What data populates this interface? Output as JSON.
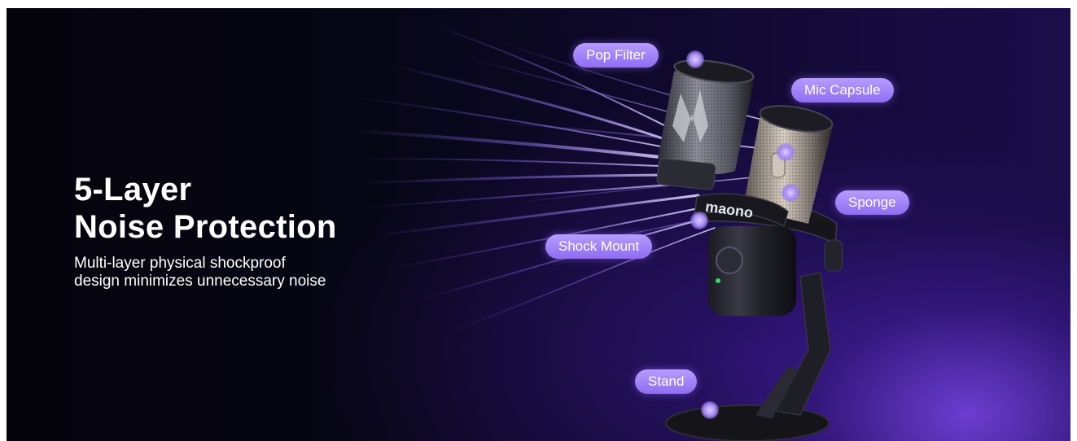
{
  "headline": {
    "line1": "5-Layer",
    "line2": "Noise Protection"
  },
  "subtext": {
    "line1": "Multi-layer physical shockproof",
    "line2": "design minimizes unnecessary noise"
  },
  "brand_mark": "maono",
  "labels": {
    "pop_filter": "Pop Filter",
    "mic_capsule": "Mic Capsule",
    "sponge": "Sponge",
    "shock_mount": "Shock Mount",
    "stand": "Stand"
  },
  "colors": {
    "background_dark": "#05040c",
    "background_purple": "#1b0d4a",
    "glow_purple": "#7846e6",
    "label_fill": "#9b7bf5",
    "text": "#ffffff"
  }
}
